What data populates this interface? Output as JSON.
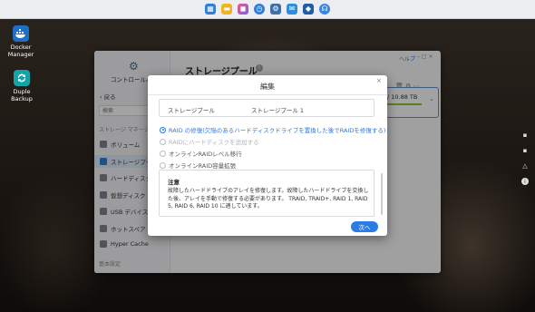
{
  "desktop": {
    "icons": [
      {
        "label": "Docker Manager",
        "icon": "docker-whale-icon"
      },
      {
        "label": "Duple Backup",
        "icon": "sync-arrows-icon"
      }
    ]
  },
  "taskbar": {
    "icons": [
      "app-grid-icon",
      "folder-icon",
      "photo-icon",
      "clock-icon",
      "gear-icon",
      "mail-icon",
      "cube-icon",
      "headset-icon"
    ]
  },
  "window": {
    "title": "ストレージプール",
    "help_link": "ヘルプ",
    "sidebar": {
      "control_panel": "コントロールパ",
      "back": "戻る",
      "search_placeholder": "検索",
      "section_storage": "ストレージ マネージ",
      "items": [
        "ボリューム",
        "ストレージプー",
        "ハードディスク",
        "仮想ディスク",
        "USB デバイス",
        "ホットスペア",
        "Hyper Cache"
      ],
      "section_basic": "基本設定"
    },
    "pool_capacity": "/ 10.88 TB"
  },
  "dialog": {
    "title": "編集",
    "close": "×",
    "pool_label": "ストレージプール",
    "pool_value": "ストレージプール 1",
    "options": [
      "RAID の修復(欠陥のあるハードディスクドライブを置換した後でRAIDを修復する)",
      "RAIDにハードディスクを追加する",
      "オンラインRAIDレベル移行",
      "オンラインRAID容量拡張"
    ],
    "selected_index": 0,
    "note_title": "注意",
    "note_text": "故障したハードドライブのアレイを修復します。故障したハードドライブを交換した後、アレイを手動で修復する必要があります。 TRAID, TRAID+, RAID 1, RAID 5, RAID 6, RAID 10 に適しています。",
    "next_button": "次へ"
  }
}
